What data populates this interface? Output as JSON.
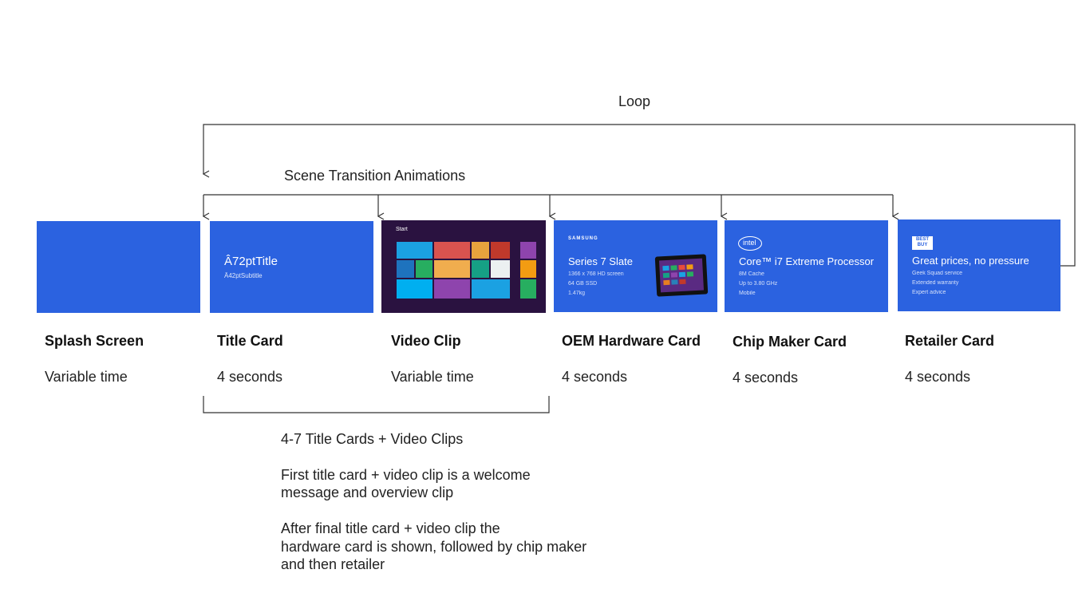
{
  "labels": {
    "loop": "Loop",
    "transitions": "Scene Transition Animations"
  },
  "cards": [
    {
      "name": "Splash Screen",
      "duration": "Variable time"
    },
    {
      "name": "Title Card",
      "duration": "4 seconds",
      "title": "Â72ptTitle",
      "subtitle": "Â42ptSubtitle"
    },
    {
      "name": "Video Clip",
      "duration": "Variable time",
      "start_label": "Start"
    },
    {
      "name": "OEM Hardware Card",
      "duration": "4 seconds",
      "brand": "SAMSUNG",
      "product": "Series 7 Slate",
      "specs": [
        "1366 x 768 HD screen",
        "64 GB SSD",
        "1.47kg"
      ]
    },
    {
      "name": "Chip Maker Card",
      "duration": "4 seconds",
      "brand": "intel",
      "product": "Core™ i7 Extreme Processor",
      "specs": [
        "8M Cache",
        "Up to 3.80 GHz",
        "Mobile"
      ]
    },
    {
      "name": "Retailer Card",
      "duration": "4 seconds",
      "brand": "BEST BUY",
      "product": "Great prices, no pressure",
      "specs": [
        "Geek Squad service",
        "Extended warranty",
        "Expert advice"
      ]
    }
  ],
  "notes": {
    "heading": "4-7 Title Cards + Video Clips",
    "p1_line1": "First title card + video clip is a welcome",
    "p1_line2": "message and overview clip",
    "p2_line1": "After final title card + video clip the",
    "p2_line2": "hardware card is shown, followed by chip maker",
    "p2_line3": "and then retailer"
  },
  "colors": {
    "card_blue": "#2b62e0",
    "start_screen_bg": "#2a1240",
    "line": "#333333"
  }
}
